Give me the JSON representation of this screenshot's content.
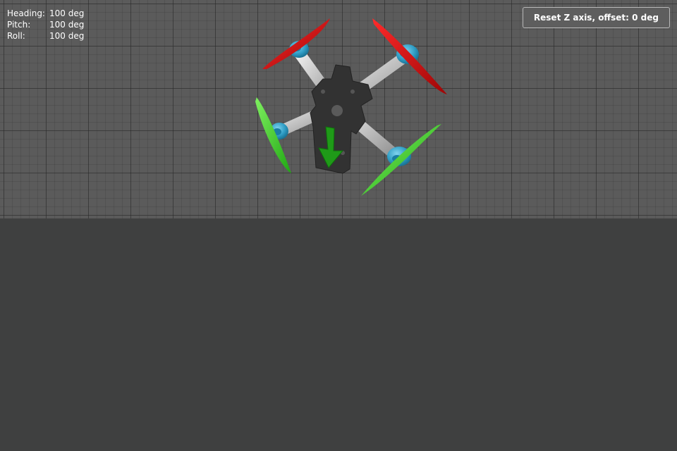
{
  "attitude": {
    "heading": {
      "label": "Heading:",
      "value": "100 deg"
    },
    "pitch": {
      "label": "Pitch:",
      "value": "100 deg"
    },
    "roll": {
      "label": "Roll:",
      "value": "100 deg"
    }
  },
  "toolbar": {
    "reset_label": "Reset Z axis, offset: 0 deg"
  },
  "colors": {
    "grid_background": "#5b5b5b",
    "panel_background": "#3f4040",
    "front_props": "#cc0a0a",
    "rear_props": "#2fc21d",
    "motors": "#3aa6c9",
    "frame": "#333333",
    "direction_arrow": "#1f9a18"
  },
  "model": {
    "icon": "quadcopter-model"
  }
}
